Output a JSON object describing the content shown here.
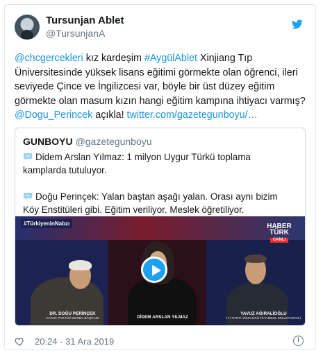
{
  "tweet": {
    "author_name": "Tursunjan Ablet",
    "author_handle": "@TursunjanA",
    "text_parts": [
      {
        "text": "@chcgercekleri",
        "link": true
      },
      {
        "text": " kız kardeşim ",
        "link": false
      },
      {
        "text": "#AygülAblet",
        "link": true
      },
      {
        "text": " Xinjiang Tıp Üniversitesinde yüksek lisans eğitimi görmekte olan öğrenci, ileri seviyede Çince ve İngilizcesi var, böyle bir üst düzey eğitim görmekte olan masum kızın hangi eğitim kampına ihtiyacı varmış? ",
        "link": false
      },
      {
        "text": "@Dogu_Perincek",
        "link": true
      },
      {
        "text": " açıkla! ",
        "link": false
      },
      {
        "text": "twitter.com/gazetegunboyu/…",
        "link": true
      }
    ],
    "time": "20:24 - 31 Ara 2019",
    "info_label": "i",
    "brand_color": "#1da1f2",
    "link_color": "#1b95e0"
  },
  "quoted": {
    "name": "GUNBOYU",
    "handle": "@gazetegunboyu",
    "paragraphs": [
      "Didem Arslan Yılmaz: 1 milyon Uygur Türkü toplama kamplarda tutuluyor.",
      "Doğu Perinçek: Yalan baştan aşağı yalan. Orası aynı bizim Köy Enstitüleri gibi. Eğitim veriliyor. Meslek öğretiliyor."
    ],
    "video": {
      "hashtag": "#TürkiyeninNabzı",
      "channel_logo": "HABER TÜRK",
      "live_label": "CANLI",
      "captions": [
        {
          "name": "DR. DOĞU PERİNÇEK",
          "title": "VATAN PARTİSİ GENEL BAŞKANI"
        },
        {
          "name": "DİDEM ARSLAN YILMAZ",
          "title": ""
        },
        {
          "name": "YAVUZ AĞIRALİOĞLU",
          "title": "İYİ PARTİ SÖZCÜSÜ-İSTANBUL MİLLETVEKİLİ"
        }
      ]
    }
  },
  "icons": [
    "twitter-bird-icon",
    "speech-bubble-icon",
    "play-icon",
    "heart-icon",
    "info-icon"
  ]
}
